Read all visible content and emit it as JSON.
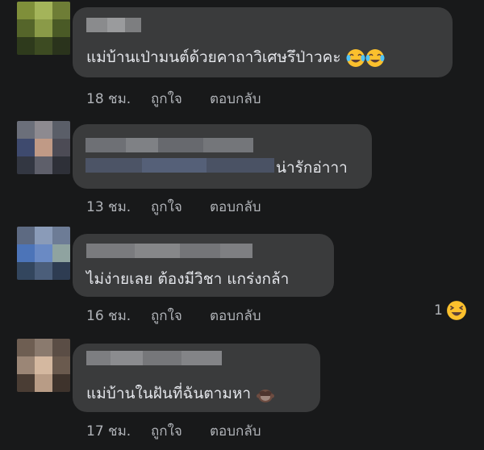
{
  "comments": [
    {
      "text": "แม่บ้านเป่ามนต์ด้วยคาถาวิเศษรึป่าวคะ",
      "time": "18 ชม.",
      "like": "ถูกใจ",
      "reply": "ตอบกลับ",
      "trailing_emoji": [
        "face-with-tears-of-joy-icon",
        "face-with-tears-of-joy-icon"
      ]
    },
    {
      "text": "น่ารักอ่าาา",
      "time": "13 ชม.",
      "like": "ถูกใจ",
      "reply": "ตอบกลับ"
    },
    {
      "text": "ไม่ง่ายเลย ต้องมีวิชา แกร่งกล้า",
      "time": "16 ชม.",
      "like": "ถูกใจ",
      "reply": "ตอบกลับ",
      "reaction": {
        "count": "1",
        "icon": "laughing-face-icon"
      }
    },
    {
      "text": "แม่บ้านในฝันที่ฉันตามหา",
      "time": "17 ชม.",
      "like": "ถูกใจ",
      "reply": "ตอบกลับ",
      "trailing_emoji": [
        "see-no-evil-icon"
      ]
    }
  ],
  "colors": {
    "background": "#18191a",
    "bubble": "#3a3b3c",
    "text": "#e4e6eb",
    "meta": "#b0b3b8",
    "emoji_yellow": "#fbc02d"
  }
}
